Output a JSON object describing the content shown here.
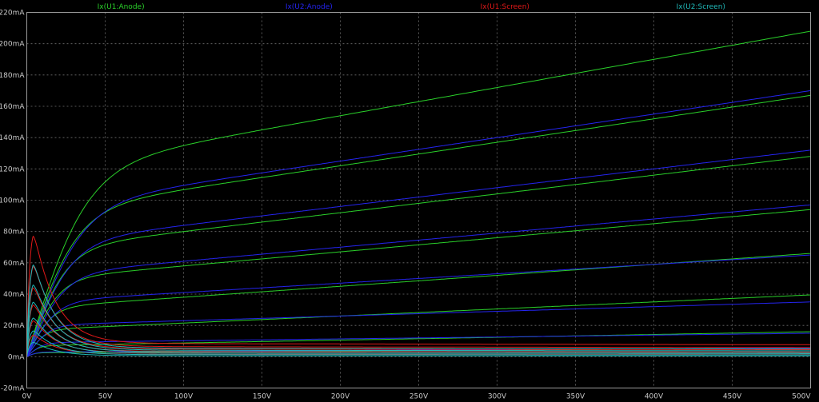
{
  "chart_data": {
    "type": "line",
    "xlim": [
      0,
      500
    ],
    "ylim": [
      -20,
      220
    ],
    "x_ticks": [
      "0V",
      "50V",
      "100V",
      "150V",
      "200V",
      "250V",
      "300V",
      "350V",
      "400V",
      "450V",
      "500V"
    ],
    "y_ticks": [
      "220mA",
      "200mA",
      "180mA",
      "160mA",
      "140mA",
      "120mA",
      "100mA",
      "80mA",
      "60mA",
      "40mA",
      "20mA",
      "0mA",
      "-20mA"
    ],
    "x_tick_values": [
      0,
      50,
      100,
      150,
      200,
      250,
      300,
      350,
      400,
      450,
      500
    ],
    "y_tick_values": [
      220,
      200,
      180,
      160,
      140,
      120,
      100,
      80,
      60,
      40,
      20,
      0,
      -20
    ],
    "grid": true,
    "legend_position": "top",
    "series": [
      {
        "name": "Ix(U1:Anode)",
        "color": "#2ad02a",
        "curves": [
          {
            "knee": 60,
            "plateau": 118,
            "slope": 0.18
          },
          {
            "knee": 50,
            "plateau": 92,
            "slope": 0.15
          },
          {
            "knee": 40,
            "plateau": 68,
            "slope": 0.12
          },
          {
            "knee": 32,
            "plateau": 49,
            "slope": 0.09
          },
          {
            "knee": 25,
            "plateau": 31,
            "slope": 0.07
          },
          {
            "knee": 18,
            "plateau": 17,
            "slope": 0.045
          },
          {
            "knee": 12,
            "plateau": 7,
            "slope": 0.018
          },
          {
            "knee": 8,
            "plateau": 2.5,
            "slope": 0.006
          }
        ]
      },
      {
        "name": "Ix(U2:Anode)",
        "color": "#2424ee",
        "curves": [
          {
            "knee": 55,
            "plateau": 95,
            "slope": 0.15
          },
          {
            "knee": 45,
            "plateau": 72,
            "slope": 0.12
          },
          {
            "knee": 38,
            "plateau": 52,
            "slope": 0.09
          },
          {
            "knee": 30,
            "plateau": 35,
            "slope": 0.06
          },
          {
            "knee": 22,
            "plateau": 20,
            "slope": 0.03
          },
          {
            "knee": 16,
            "plateau": 9,
            "slope": 0.012
          },
          {
            "knee": 10,
            "plateau": 3,
            "slope": 0.005
          }
        ]
      },
      {
        "name": "Ix(U1:Screen)",
        "color": "#e01818",
        "curves": [
          {
            "peak": 84,
            "tail": 8.5
          },
          {
            "peak": 63,
            "tail": 6.5
          },
          {
            "peak": 48,
            "tail": 5
          },
          {
            "peak": 36,
            "tail": 3.5
          },
          {
            "peak": 25,
            "tail": 2.5
          },
          {
            "peak": 15,
            "tail": 1.5
          }
        ]
      },
      {
        "name": "Ix(U2:Screen)",
        "color": "#20b8b8",
        "curves": [
          {
            "peak": 64,
            "tail": 5.5
          },
          {
            "peak": 50,
            "tail": 4.2
          },
          {
            "peak": 38,
            "tail": 3.2
          },
          {
            "peak": 27,
            "tail": 2.2
          },
          {
            "peak": 18,
            "tail": 1.3
          },
          {
            "peak": 10,
            "tail": 0.6
          }
        ]
      }
    ]
  }
}
